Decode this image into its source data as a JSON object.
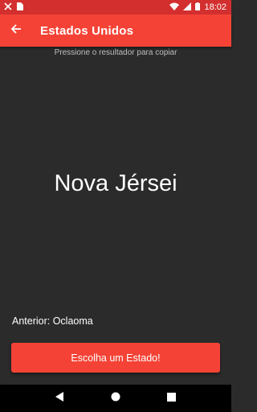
{
  "status_bar": {
    "time": "18:02",
    "icons": [
      "tools-icon",
      "sim-card-icon",
      "wifi-icon",
      "signal-icon",
      "battery-icon"
    ],
    "background_color": "#d32f2f"
  },
  "app_bar": {
    "title": "Estados Unidos",
    "back_icon": "arrow-back-icon",
    "background_color": "#f44336"
  },
  "main": {
    "hint": "Pressione o resultador para copiar",
    "result": "Nova Jérsei",
    "previous": "Anterior: Oclaoma",
    "action_label": "Escolha um Estado!",
    "background_color": "#2b2b2b"
  },
  "nav_bar": {
    "buttons": [
      "back-triangle-icon",
      "home-circle-icon",
      "recents-square-icon"
    ]
  }
}
